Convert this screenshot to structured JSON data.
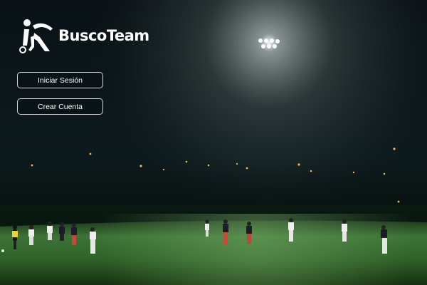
{
  "app": {
    "brand_name": "BuscoTeam",
    "logo_icon": "player-kicking-ball-icon"
  },
  "actions": {
    "login_label": "Iniciar Sesión",
    "signup_label": "Crear Cuenta"
  },
  "colors": {
    "background": "#0b1418",
    "turf": "#3e7a38",
    "button_border": "#d8d8d8",
    "text": "#ffffff"
  }
}
